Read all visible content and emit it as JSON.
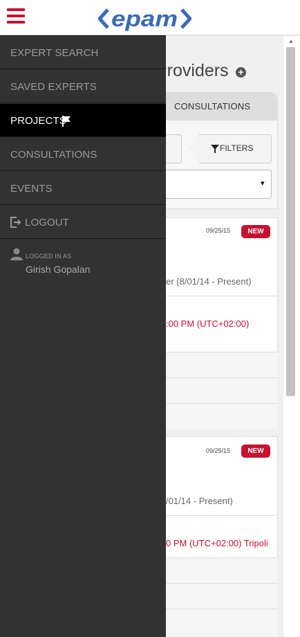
{
  "header": {
    "logo_text": "<epam>",
    "brand_color": "#c8102e",
    "logo_color": "#3a6bb5",
    "menu_icon": "hamburger-icon"
  },
  "main": {
    "title": "Providers",
    "add_icon": "plus-circle-icon",
    "tab_label": "CONSULTATIONS",
    "filters_label": "FILTERS",
    "filters_icon": "funnel-icon",
    "select_caret": "▾",
    "cards": [
      {
        "date": "09/25/15",
        "badge": "NEW",
        "text": "er (8/01/14 - Present)",
        "time": ":00 PM (UTC+02:00)"
      },
      {
        "date": "09/25/15",
        "badge": "NEW",
        "text": "/01/14 - Present)",
        "time": "0 PM (UTC+02:00) Tripoli"
      }
    ]
  },
  "drawer": {
    "items": [
      {
        "label": "EXPERT SEARCH",
        "active": false
      },
      {
        "label": "SAVED EXPERTS",
        "active": false
      },
      {
        "label": "PROJECTS",
        "active": true,
        "icon": "flag-icon"
      },
      {
        "label": "CONSULTATIONS",
        "active": false
      },
      {
        "label": "EVENTS",
        "active": false
      },
      {
        "label": "LOGOUT",
        "active": false,
        "icon": "logout-icon"
      }
    ],
    "logged_in_label": "LOGGED IN AS",
    "user_name": "Girish Gopalan",
    "user_icon": "user-icon"
  }
}
